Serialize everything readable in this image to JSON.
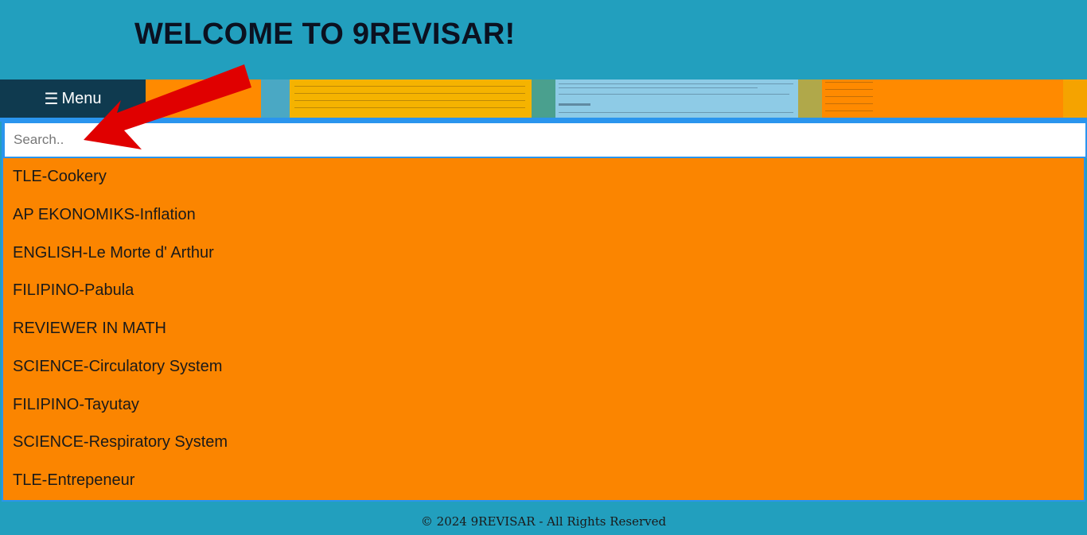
{
  "header": {
    "title": "WELCOME TO 9REVISAR!"
  },
  "nav": {
    "menu_icon": "☰",
    "menu_label": "Menu"
  },
  "search": {
    "placeholder": "Search.."
  },
  "subjects": [
    "TLE-Cookery",
    "AP EKONOMIKS-Inflation",
    "ENGLISH-Le Morte d' Arthur",
    "FILIPINO-Pabula",
    "REVIEWER IN MATH",
    "SCIENCE-Circulatory System",
    "FILIPINO-Tayutay",
    "SCIENCE-Respiratory System",
    "TLE-Entrepeneur"
  ],
  "footer": {
    "text": "© 2024 9REVISAR - All Rights Reserved"
  },
  "colors": {
    "header_bg": "#229fbe",
    "menu_bg": "#0f3a4f",
    "list_bg": "#fb8500",
    "accent_border": "#2a95ee",
    "annotation_arrow": "#e00000"
  }
}
